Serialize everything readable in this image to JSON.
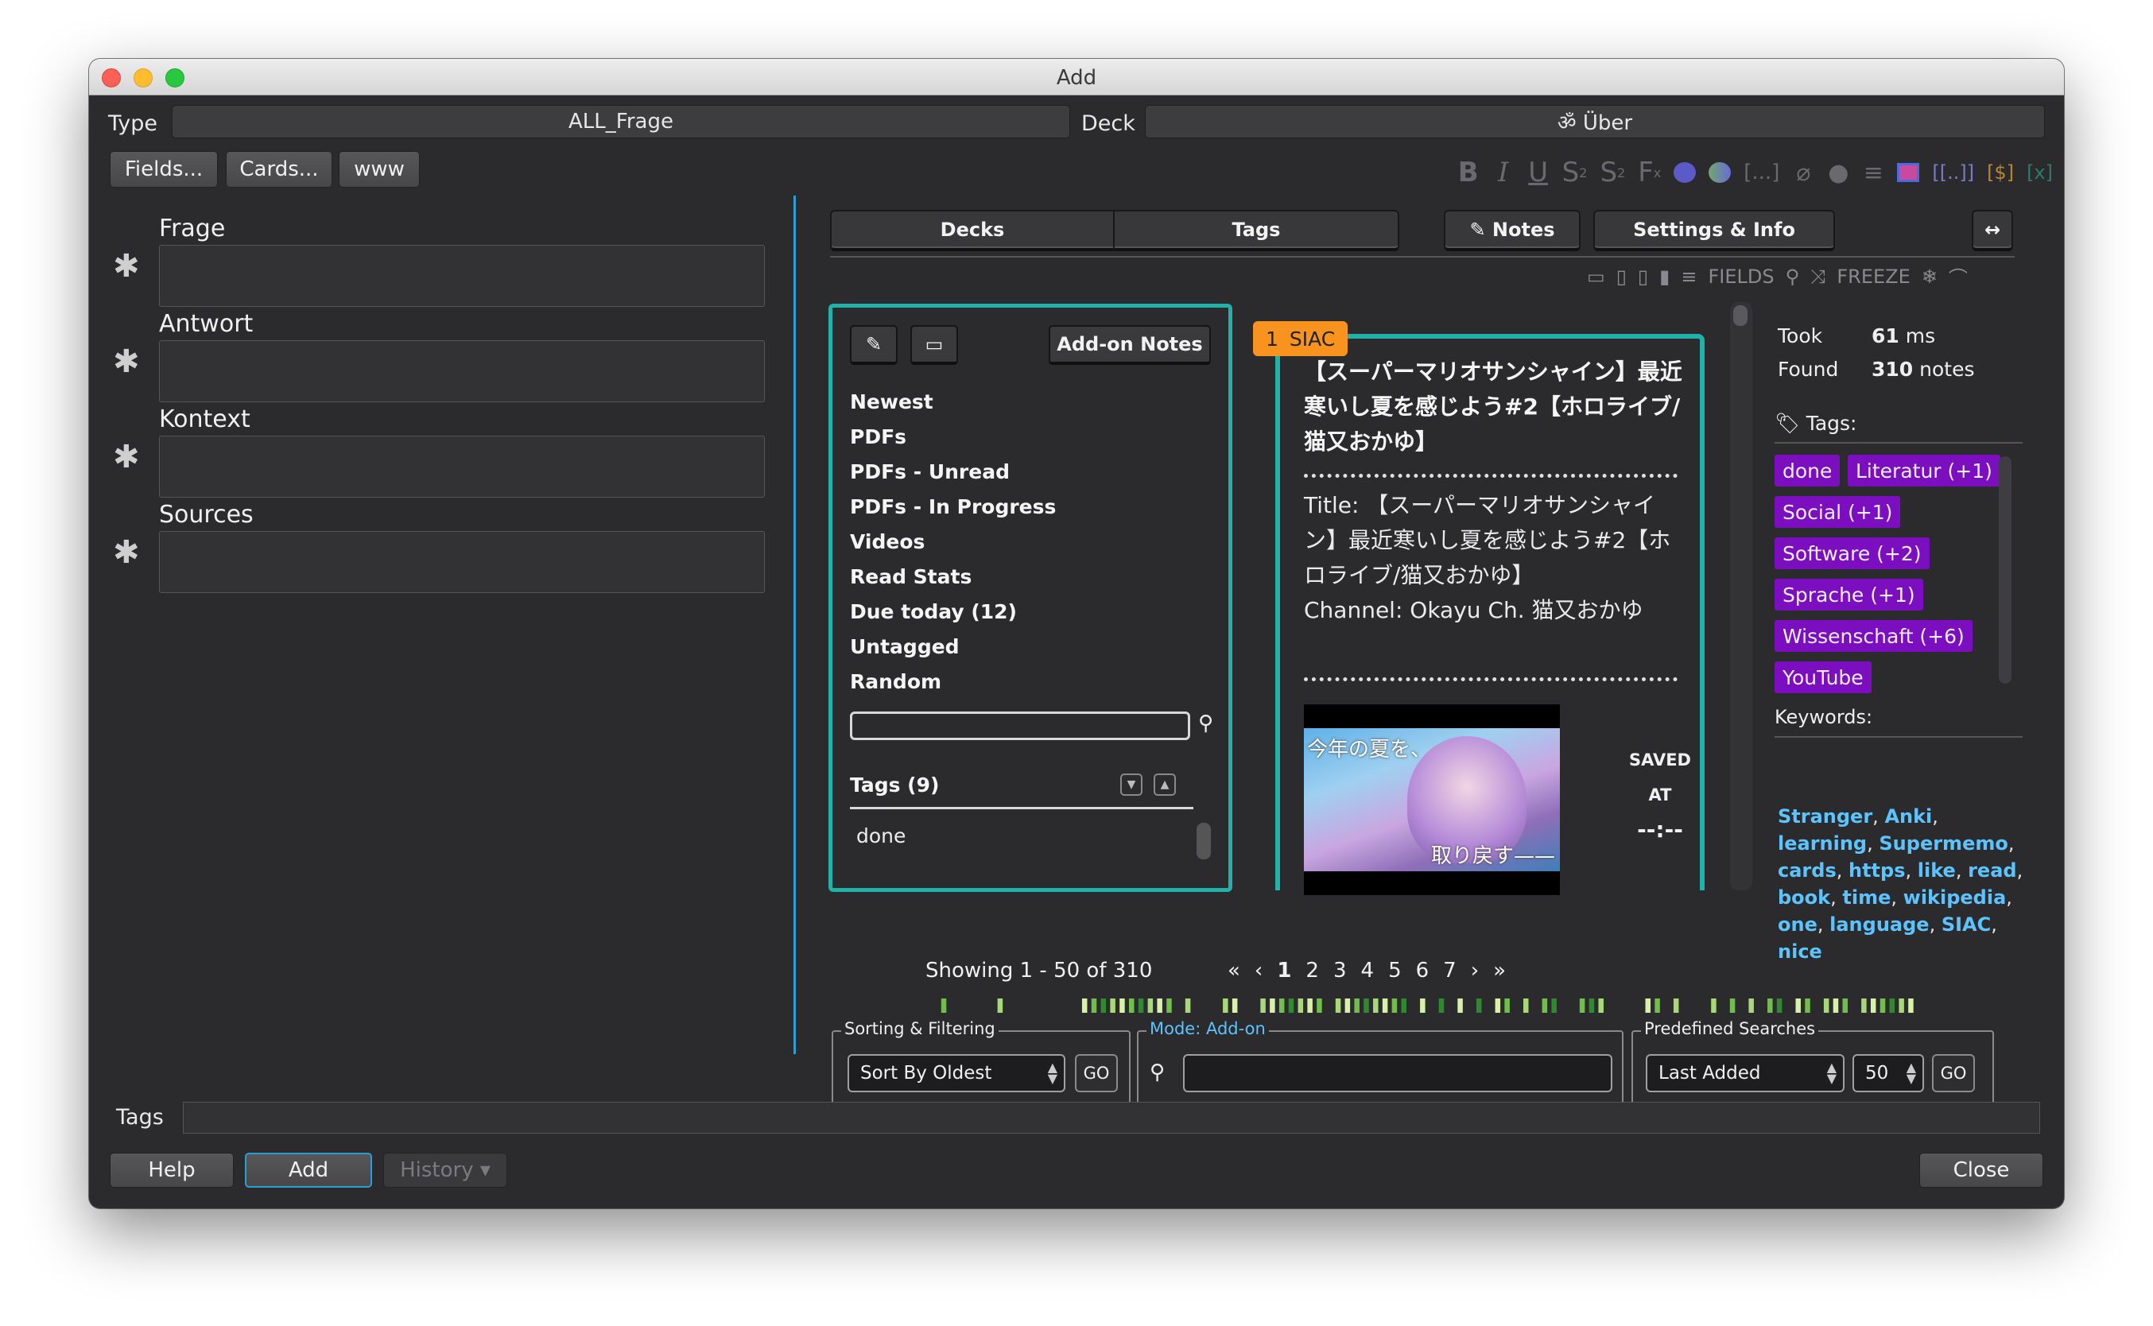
{
  "window": {
    "title": "Add"
  },
  "header": {
    "type_label": "Type",
    "type_value": "ALL_Frage",
    "deck_label": "Deck",
    "deck_value": "ॐ  Über",
    "fields_button": "Fields...",
    "cards_button": "Cards...",
    "www_button": "www"
  },
  "toolbar_icons": [
    "bold-icon",
    "italic-icon",
    "underline-icon",
    "superscript-icon",
    "subscript-icon",
    "clear-format-icon",
    "text-color-icon",
    "highlight-color-icon",
    "cloze-icon",
    "attach-icon",
    "record-icon",
    "more-icon",
    "image-icon",
    "mathjax-icon",
    "html-icon",
    "sidebar-toggle-icon"
  ],
  "fields": [
    {
      "label": "Frage",
      "value": ""
    },
    {
      "label": "Antwort",
      "value": ""
    },
    {
      "label": "Kontext",
      "value": ""
    },
    {
      "label": "Sources",
      "value": ""
    }
  ],
  "addon": {
    "tabs": {
      "decks": "Decks",
      "tags": "Tags",
      "notes": "✎ Notes",
      "settings": "Settings & Info",
      "toggle": "↔"
    },
    "fields_label": "FIELDS",
    "freeze_label": "FREEZE",
    "sidebar": {
      "addon_notes_button": "Add-on Notes",
      "items": [
        "Newest",
        "PDFs",
        "PDFs - Unread",
        "PDFs - In Progress",
        "Videos",
        "Read Stats",
        "Due today (12)",
        "Untagged",
        "Random"
      ],
      "search_value": "",
      "tags_header": "Tags (9)",
      "tag_list": [
        "done"
      ]
    },
    "result_card": {
      "index": "1",
      "badge": "SIAC",
      "title": "【スーパーマリオサンシャイン】最近寒いし夏を感じよう#2【ホロライブ/猫又おかゆ】",
      "body_line1": "Title: 【スーパーマリオサンシャイン】最近寒いし夏を感じよう#2【ホロライブ/猫又おかゆ】",
      "body_line2": "Channel: Okayu Ch. 猫又おかゆ",
      "thumb_text_top": "今年の夏を、",
      "thumb_text_bottom": "取り戻す——",
      "saved_label1": "SAVED",
      "saved_label2": "AT",
      "saved_value": "--:--"
    },
    "stats": {
      "took_label": "Took",
      "took_value": "61",
      "took_unit": "ms",
      "found_label": "Found",
      "found_value": "310",
      "found_unit": "notes",
      "tags_label": "Tags:",
      "tags": [
        "done",
        "Literatur  (+1)",
        "Social  (+1)",
        "Software  (+2)",
        "Sprache  (+1)",
        "Wissenschaft  (+6)",
        "YouTube"
      ],
      "keywords_label": "Keywords:",
      "keywords": [
        "Stranger",
        "Anki",
        "learning",
        "Supermemo",
        "cards",
        "https",
        "like",
        "read",
        "book",
        "time",
        "wikipedia",
        "one",
        "language",
        "SIAC",
        "nice"
      ]
    },
    "pager": {
      "showing": "Showing 1 - 50 of 310",
      "first": "«",
      "prev": "‹",
      "pages": [
        "1",
        "2",
        "3",
        "4",
        "5",
        "6",
        "7"
      ],
      "next": "›",
      "last": "»",
      "current_page": "1"
    },
    "sorting": {
      "title": "Sorting & Filtering",
      "value": "Sort By Oldest",
      "go": "GO"
    },
    "mode": {
      "title": "Mode: Add-on",
      "value": ""
    },
    "predefined": {
      "title": "Predefined Searches",
      "value": "Last Added",
      "count": "50",
      "go": "GO"
    }
  },
  "footer": {
    "tags_label": "Tags",
    "tags_value": "",
    "help_button": "Help",
    "add_button": "Add",
    "history_button": "History ▾",
    "close_button": "Close"
  },
  "colors": {
    "accent": "#20b2aa",
    "divider": "#2a9fd6",
    "tag_bg": "#7b0fc0",
    "keyword": "#5cc3ff",
    "badge": "#f7931e"
  }
}
